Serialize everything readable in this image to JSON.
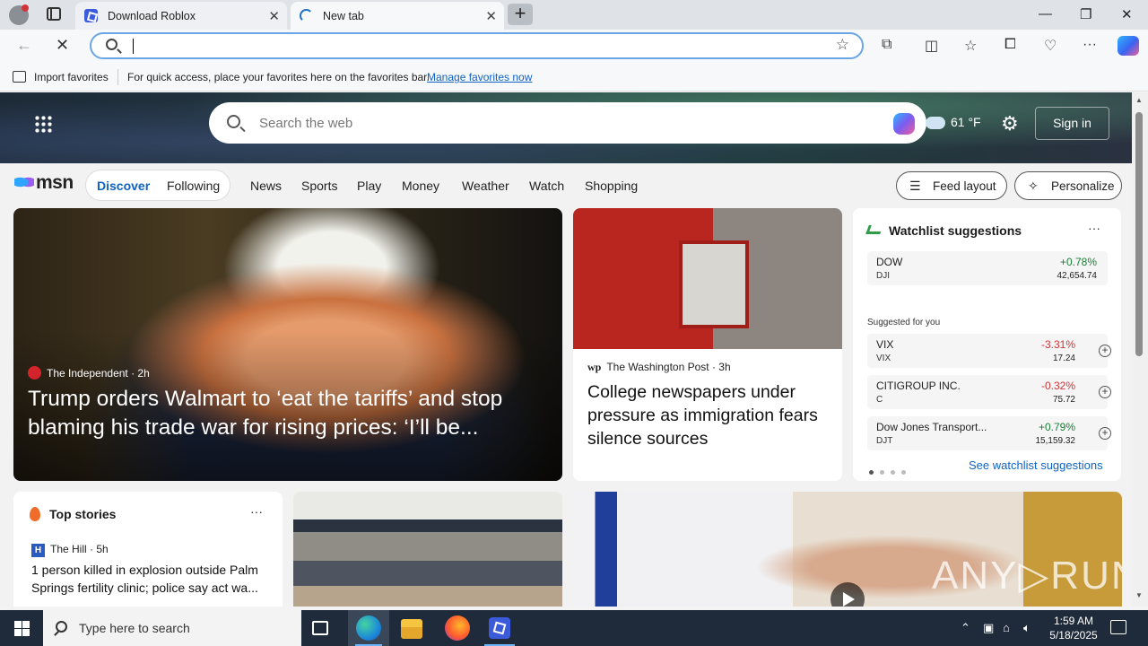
{
  "browser": {
    "tabs": [
      {
        "label": "Download Roblox"
      },
      {
        "label": "New tab"
      }
    ],
    "new_tab_symbol": "+",
    "address_value": "",
    "favorites_bar": {
      "import_label": "Import favorites",
      "message": "For quick access, place your favorites here on the favorites bar.",
      "manage_link": "Manage favorites now"
    }
  },
  "msn": {
    "search_placeholder": "Search the web",
    "weather_temp": "61 °F",
    "sign_in": "Sign in",
    "logo_text": "msn",
    "segments": {
      "active": "Discover",
      "other": "Following"
    },
    "nav_links": [
      "News",
      "Sports",
      "Play",
      "Money",
      "Weather",
      "Watch",
      "Shopping"
    ],
    "feed_layout": "Feed layout",
    "personalize": "Personalize",
    "hero_story": {
      "source": "The Independent",
      "age": "2h",
      "headline": "Trump orders Walmart to ‘eat the tariffs’ and stop blaming his trade war for rising prices: ‘I’ll be..."
    },
    "mid_story": {
      "source_logo": "wp",
      "source": "The Washington Post",
      "age": "3h",
      "headline": "College newspapers under pressure as immigration fears silence sources"
    },
    "watchlist": {
      "title": "Watchlist suggestions",
      "more": "···",
      "main": {
        "name": "DOW",
        "ticker": "DJI",
        "change": "+0.78%",
        "price": "42,654.74"
      },
      "suggested_label": "Suggested for you",
      "suggested": [
        {
          "name": "VIX",
          "ticker": "VIX",
          "change": "-3.31%",
          "price": "17.24"
        },
        {
          "name": "CITIGROUP INC.",
          "ticker": "C",
          "change": "-0.32%",
          "price": "75.72"
        },
        {
          "name": "Dow Jones Transport...",
          "ticker": "DJT",
          "change": "+0.79%",
          "price": "15,159.32"
        }
      ],
      "see_all": "See watchlist suggestions"
    },
    "top_stories": {
      "title": "Top stories",
      "more": "···",
      "source_logo": "H",
      "source": "The Hill",
      "age": "5h",
      "headline": "1 person killed in explosion outside Palm Springs fertility clinic; police say act wa..."
    },
    "watermark": "ANY▷RUN"
  },
  "taskbar": {
    "search_placeholder": "Type here to search",
    "time": "1:59 AM",
    "date": "5/18/2025"
  },
  "icons": {
    "back": "arrow-left-icon",
    "stop": "close-icon",
    "search": "search-icon",
    "favorite": "star-icon",
    "extensions": "puzzle-icon",
    "split": "split-screen-icon",
    "favorites": "favorites-icon",
    "collections": "collections-icon",
    "performance": "heart-pulse-icon",
    "menu": "more-icon",
    "copilot": "copilot-icon"
  }
}
